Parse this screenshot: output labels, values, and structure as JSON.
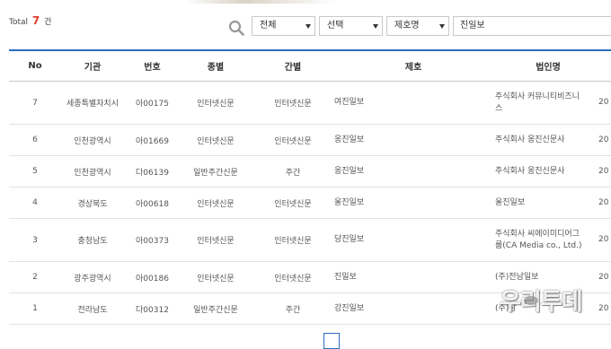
{
  "summary": {
    "total_prefix": "Total",
    "total_count": "7",
    "total_suffix": "건"
  },
  "filters": {
    "category_select": "전체",
    "option_select": "선택",
    "field_select": "제호명",
    "search_value": "진일보"
  },
  "table": {
    "headers": [
      "No",
      "기관",
      "번호",
      "종별",
      "간별",
      "제호",
      "법인명"
    ],
    "rows": [
      {
        "no": "7",
        "agency": "세종특별자치시",
        "reg_no": "아00175",
        "type": "인터넷신문",
        "period": "인터넷신문",
        "title": "여진일보",
        "corp": [
          "주식회사 커뮤니티비즈니",
          "스"
        ],
        "extra": "20"
      },
      {
        "no": "6",
        "agency": "인천광역시",
        "reg_no": "아01669",
        "type": "인터넷신문",
        "period": "인터넷신문",
        "title": "옹진일보",
        "corp": [
          "주식회사 옹진신문사"
        ],
        "extra": "20"
      },
      {
        "no": "5",
        "agency": "인천광역시",
        "reg_no": "다06139",
        "type": "일반주간신문",
        "period": "주간",
        "title": "옹진일보",
        "corp": [
          "주식회사 옹진신문사"
        ],
        "extra": "20"
      },
      {
        "no": "4",
        "agency": "경상북도",
        "reg_no": "아00618",
        "type": "인터넷신문",
        "period": "인터넷신문",
        "title": "울진일보",
        "corp": [
          "울진일보"
        ],
        "extra": "20"
      },
      {
        "no": "3",
        "agency": "충청남도",
        "reg_no": "아00373",
        "type": "인터넷신문",
        "period": "인터넷신문",
        "title": "당진일보",
        "corp": [
          "주식회사 씨에이미디어그",
          "룹(CA Media co., Ltd.)"
        ],
        "extra": "20"
      },
      {
        "no": "2",
        "agency": "광주광역시",
        "reg_no": "아00186",
        "type": "인터넷신문",
        "period": "인터넷신문",
        "title": "진일보",
        "corp": [
          "(주)전남일보"
        ],
        "extra": "20"
      },
      {
        "no": "1",
        "agency": "전라남도",
        "reg_no": "다00312",
        "type": "일반주간신문",
        "period": "주간",
        "title": "강진일보",
        "corp": [
          "(주)남"
        ],
        "extra": "20"
      }
    ]
  },
  "watermark": {
    "text": "우리투데"
  },
  "colors": {
    "accent": "#2d6cc0",
    "count": "#e13b2d"
  }
}
